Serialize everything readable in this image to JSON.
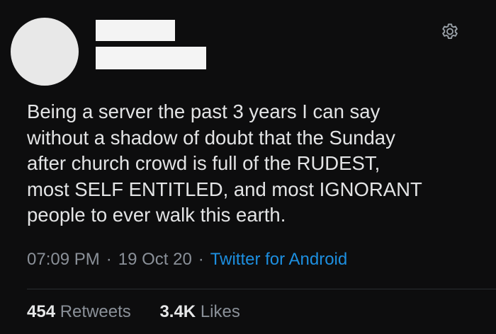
{
  "tweet": {
    "lines": [
      "Being a server the past 3 years I can say",
      "without a shadow of doubt that the Sunday",
      "after church crowd is full of the RUDEST,",
      "most SELF ENTITLED, and most IGNORANT",
      "people to ever walk this earth."
    ],
    "time": "07:09 PM",
    "separator": "·",
    "date": "19 Oct 20",
    "source": "Twitter for Android"
  },
  "stats": {
    "retweets_count": "454",
    "retweets_label": "Retweets",
    "likes_count": "3.4K",
    "likes_label": "Likes"
  },
  "icons": {
    "settings": "gear-icon"
  },
  "colors": {
    "background": "#0d0d0e",
    "text": "#e3e4e5",
    "muted": "#8a9098",
    "link": "#1d8fe0"
  }
}
